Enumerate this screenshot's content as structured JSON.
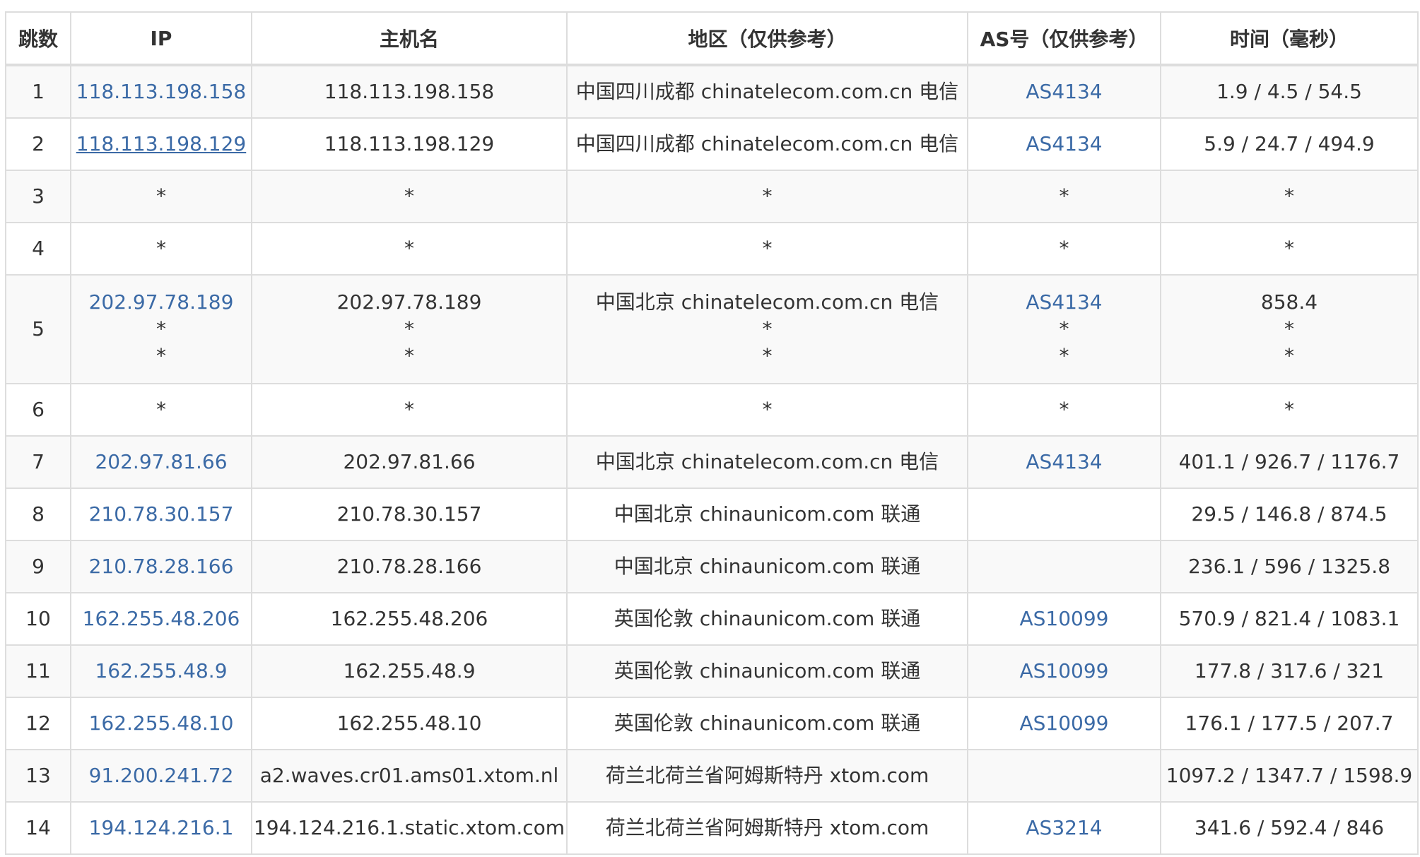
{
  "headers": {
    "hop": "跳数",
    "ip": "IP",
    "hostname": "主机名",
    "region": "地区（仅供参考）",
    "asn": "AS号（仅供参考）",
    "time": "时间（毫秒）"
  },
  "rows": [
    {
      "hop": "1",
      "ip": [
        "118.113.198.158"
      ],
      "hostname": [
        "118.113.198.158"
      ],
      "region": [
        "中国四川成都 chinatelecom.com.cn 电信"
      ],
      "asn": [
        "AS4134"
      ],
      "time": [
        "1.9 / 4.5 / 54.5"
      ]
    },
    {
      "hop": "2",
      "ip": [
        "118.113.198.129"
      ],
      "hostname": [
        "118.113.198.129"
      ],
      "region": [
        "中国四川成都 chinatelecom.com.cn 电信"
      ],
      "asn": [
        "AS4134"
      ],
      "time": [
        "5.9 / 24.7 / 494.9"
      ],
      "ip_underlined": true
    },
    {
      "hop": "3",
      "ip": [
        "*"
      ],
      "hostname": [
        "*"
      ],
      "region": [
        "*"
      ],
      "asn": [
        "*"
      ],
      "time": [
        "*"
      ]
    },
    {
      "hop": "4",
      "ip": [
        "*"
      ],
      "hostname": [
        "*"
      ],
      "region": [
        "*"
      ],
      "asn": [
        "*"
      ],
      "time": [
        "*"
      ]
    },
    {
      "hop": "5",
      "ip": [
        "202.97.78.189",
        "*",
        "*"
      ],
      "hostname": [
        "202.97.78.189",
        "*",
        "*"
      ],
      "region": [
        "中国北京 chinatelecom.com.cn 电信",
        "*",
        "*"
      ],
      "asn": [
        "AS4134",
        "*",
        "*"
      ],
      "time": [
        "858.4",
        "*",
        "*"
      ]
    },
    {
      "hop": "6",
      "ip": [
        "*"
      ],
      "hostname": [
        "*"
      ],
      "region": [
        "*"
      ],
      "asn": [
        "*"
      ],
      "time": [
        "*"
      ]
    },
    {
      "hop": "7",
      "ip": [
        "202.97.81.66"
      ],
      "hostname": [
        "202.97.81.66"
      ],
      "region": [
        "中国北京 chinatelecom.com.cn 电信"
      ],
      "asn": [
        "AS4134"
      ],
      "time": [
        "401.1 / 926.7 / 1176.7"
      ]
    },
    {
      "hop": "8",
      "ip": [
        "210.78.30.157"
      ],
      "hostname": [
        "210.78.30.157"
      ],
      "region": [
        "中国北京 chinaunicom.com 联通"
      ],
      "asn": [
        ""
      ],
      "time": [
        "29.5 / 146.8 / 874.5"
      ]
    },
    {
      "hop": "9",
      "ip": [
        "210.78.28.166"
      ],
      "hostname": [
        "210.78.28.166"
      ],
      "region": [
        "中国北京 chinaunicom.com 联通"
      ],
      "asn": [
        ""
      ],
      "time": [
        "236.1 / 596 / 1325.8"
      ]
    },
    {
      "hop": "10",
      "ip": [
        "162.255.48.206"
      ],
      "hostname": [
        "162.255.48.206"
      ],
      "region": [
        "英国伦敦 chinaunicom.com 联通"
      ],
      "asn": [
        "AS10099"
      ],
      "time": [
        "570.9 / 821.4 / 1083.1"
      ]
    },
    {
      "hop": "11",
      "ip": [
        "162.255.48.9"
      ],
      "hostname": [
        "162.255.48.9"
      ],
      "region": [
        "英国伦敦 chinaunicom.com 联通"
      ],
      "asn": [
        "AS10099"
      ],
      "time": [
        "177.8 / 317.6 / 321"
      ]
    },
    {
      "hop": "12",
      "ip": [
        "162.255.48.10"
      ],
      "hostname": [
        "162.255.48.10"
      ],
      "region": [
        "英国伦敦 chinaunicom.com 联通"
      ],
      "asn": [
        "AS10099"
      ],
      "time": [
        "176.1 / 177.5 / 207.7"
      ]
    },
    {
      "hop": "13",
      "ip": [
        "91.200.241.72"
      ],
      "hostname": [
        "a2.waves.cr01.ams01.xtom.nl"
      ],
      "region": [
        "荷兰北荷兰省阿姆斯特丹 xtom.com"
      ],
      "asn": [
        ""
      ],
      "time": [
        "1097.2 / 1347.7 / 1598.9"
      ]
    },
    {
      "hop": "14",
      "ip": [
        "194.124.216.1"
      ],
      "hostname": [
        "194.124.216.1.static.xtom.com"
      ],
      "region": [
        "荷兰北荷兰省阿姆斯特丹 xtom.com"
      ],
      "asn": [
        "AS3214"
      ],
      "time": [
        "341.6 / 592.4 / 846"
      ]
    }
  ],
  "colors": {
    "link": "#3b6aa6",
    "text": "#333333",
    "border": "#dddddd",
    "stripe": "#f9f9f9"
  }
}
